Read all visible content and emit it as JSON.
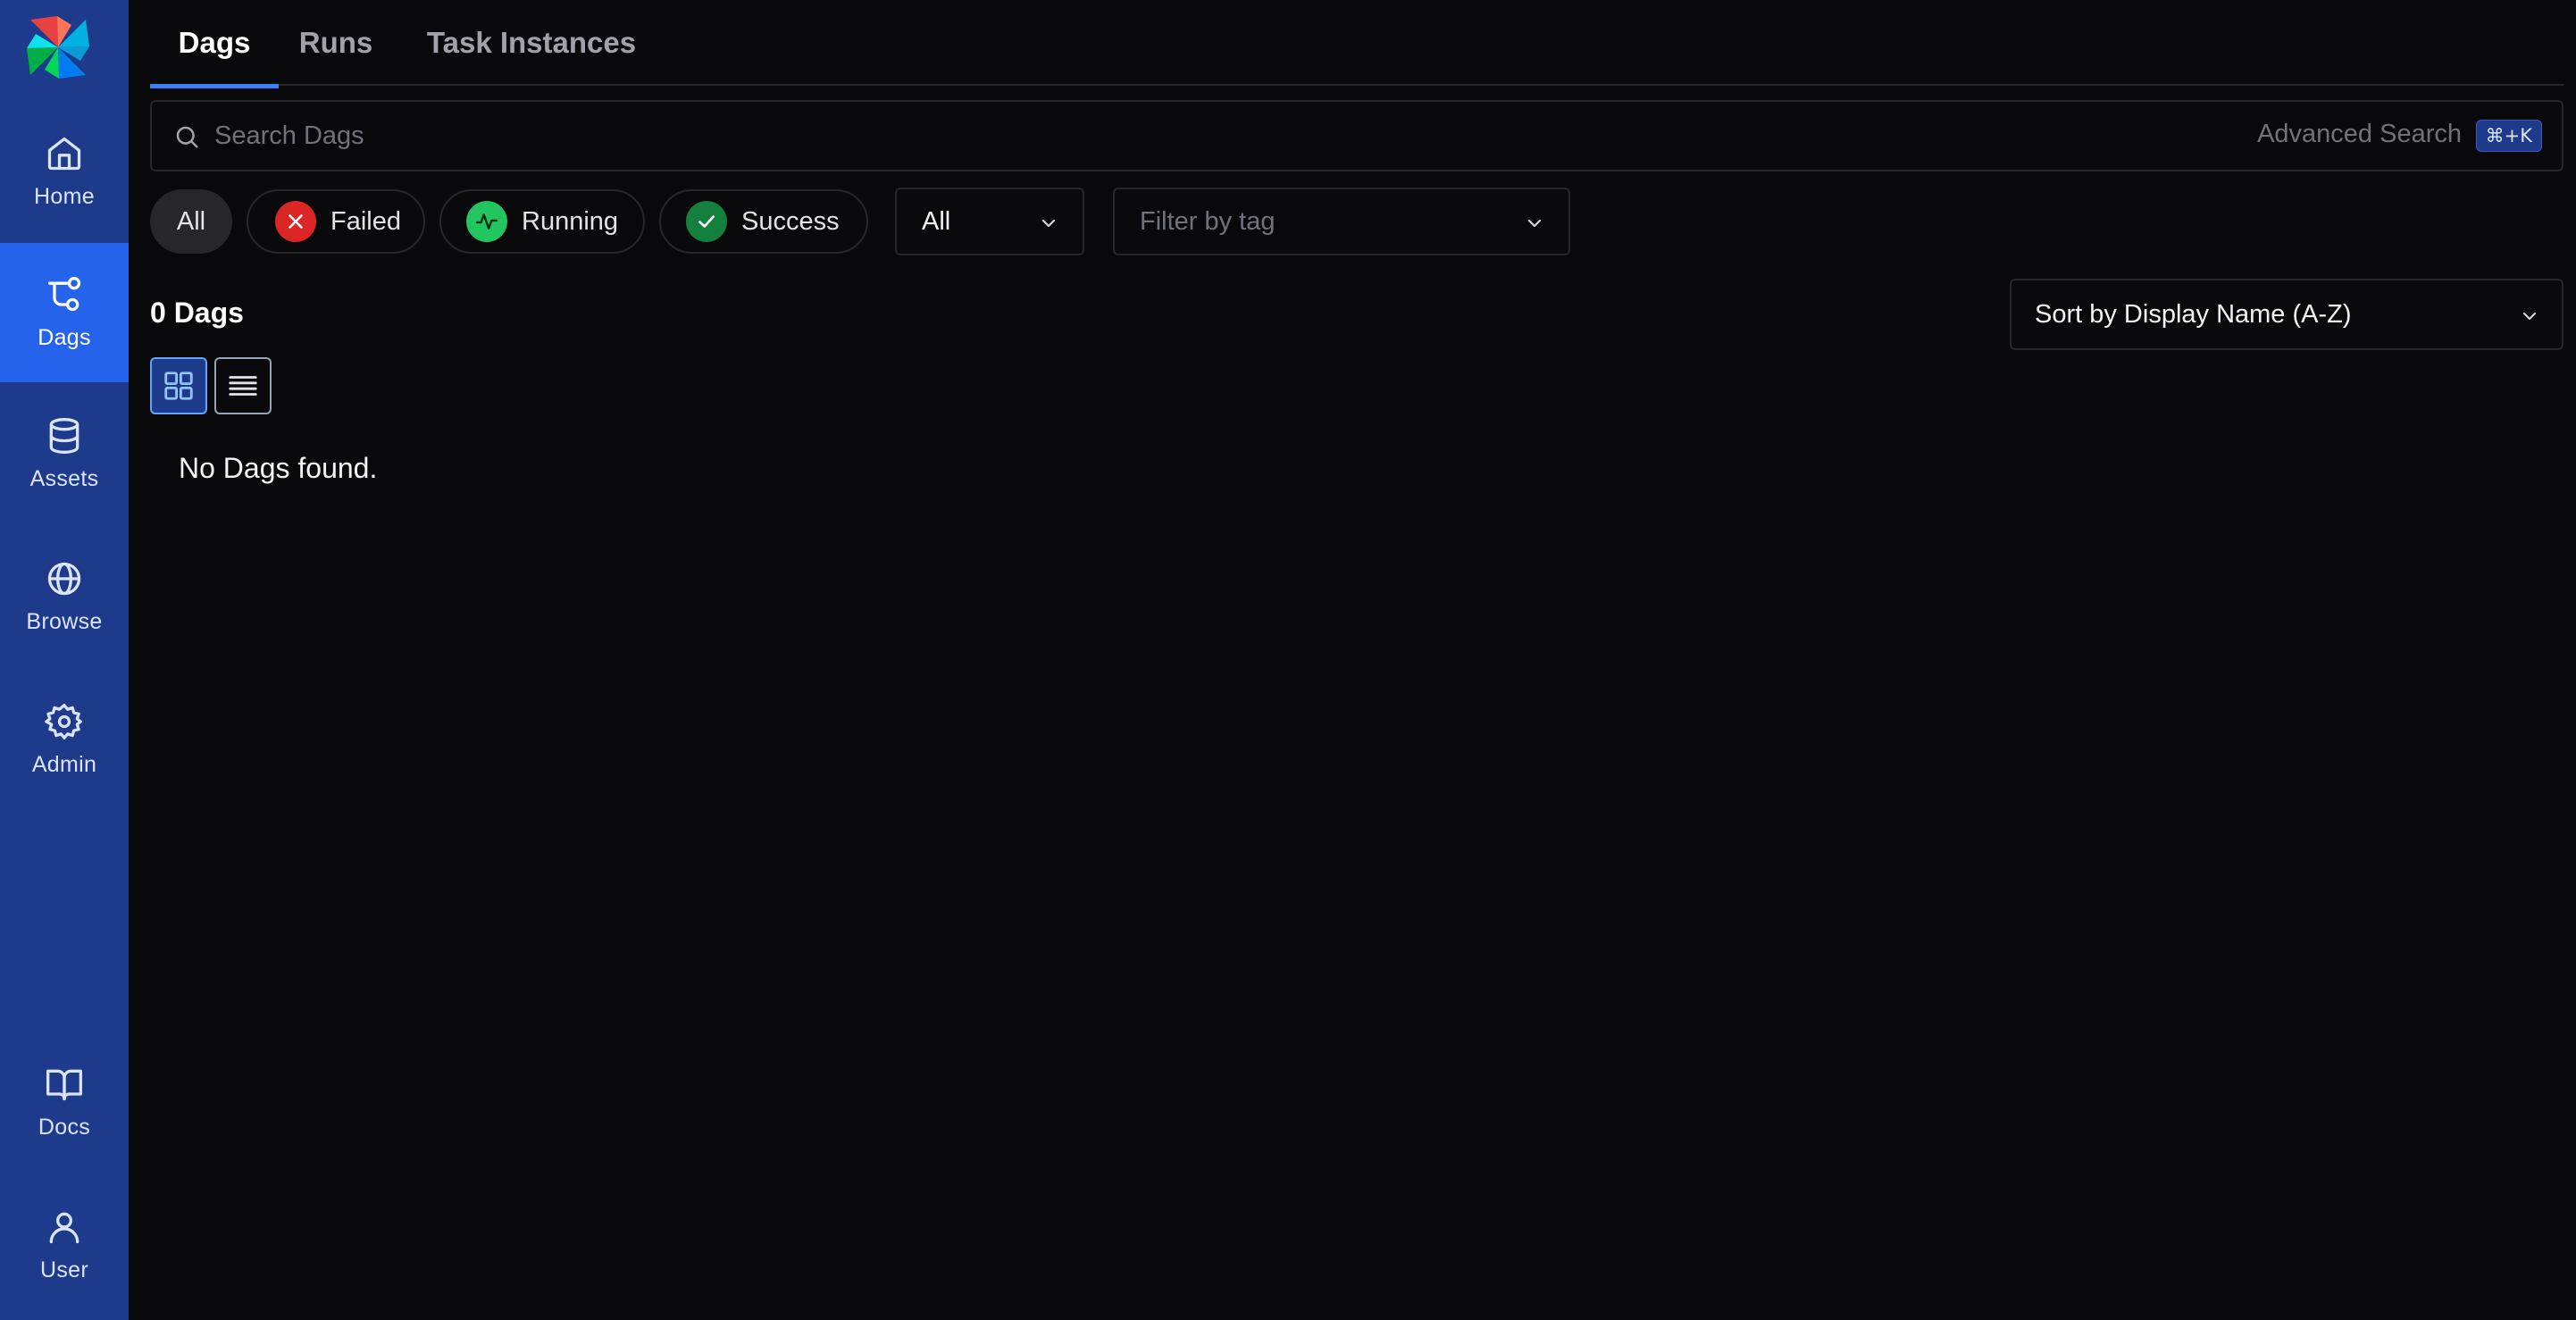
{
  "sidebar": {
    "logo": "airflow-pinwheel-logo",
    "items": [
      {
        "label": "Home",
        "icon": "home-icon"
      },
      {
        "label": "Dags",
        "icon": "dags-icon",
        "active": true
      },
      {
        "label": "Assets",
        "icon": "database-icon"
      },
      {
        "label": "Browse",
        "icon": "globe-icon"
      },
      {
        "label": "Admin",
        "icon": "gear-icon"
      },
      {
        "label": "Docs",
        "icon": "book-icon"
      },
      {
        "label": "User",
        "icon": "user-icon"
      }
    ]
  },
  "tabs": [
    {
      "label": "Dags",
      "active": true
    },
    {
      "label": "Runs"
    },
    {
      "label": "Task Instances"
    }
  ],
  "search": {
    "placeholder": "Search Dags",
    "advanced_label": "Advanced Search",
    "shortcut": "⌘+K"
  },
  "filters": {
    "state_all": "All",
    "failed": "Failed",
    "running": "Running",
    "success": "Success",
    "paused_select": "All",
    "tag_placeholder": "Filter by tag"
  },
  "results": {
    "count_label": "0 Dags",
    "sort_label": "Sort by Display Name (A-Z)",
    "empty_message": "No Dags found."
  },
  "colors": {
    "sidebar": "#1e3a8a",
    "sidebar_active": "#2563eb",
    "background": "#09090b",
    "failed": "#dc2626",
    "running": "#22c55e",
    "success": "#15803d",
    "accent": "#3b82f6"
  }
}
